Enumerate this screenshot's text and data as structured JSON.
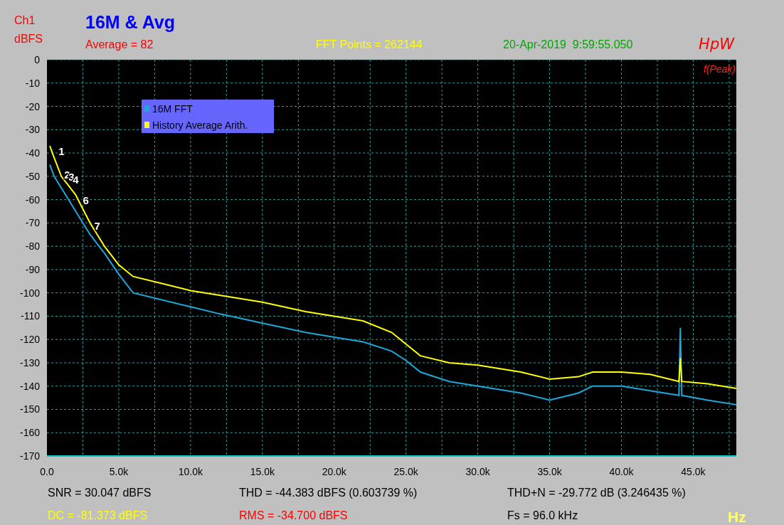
{
  "header": {
    "channel": "Ch1",
    "unit": "dBFS",
    "title": "16M & Avg",
    "average": "Average = 82",
    "fft_points": "FFT Points = 262144",
    "timestamp": "20-Apr-2019  9:59:55.050",
    "logo": "HpW"
  },
  "plot": {
    "corner_label": "f(Peak)",
    "chart_data": {
      "type": "line",
      "xlim": [
        0,
        48000
      ],
      "ylim": [
        -170,
        0
      ],
      "x": [
        200,
        500,
        1000,
        1500,
        2000,
        2500,
        3000,
        3500,
        4000,
        5000,
        6000,
        8000,
        10000,
        12000,
        15000,
        18000,
        20000,
        22000,
        24000,
        25000,
        26000,
        28000,
        30000,
        33000,
        35000,
        37000,
        38000,
        40000,
        42000,
        44000,
        44100,
        44200,
        46000,
        48000
      ],
      "series": [
        {
          "name": "16M FFT",
          "color": "#1ca8d8",
          "values": [
            -45,
            -50,
            -55,
            -60,
            -65,
            -70,
            -75,
            -79,
            -83,
            -92,
            -100,
            -103,
            -106,
            -109,
            -113,
            -117,
            -119,
            -121,
            -125,
            -129,
            -134,
            -138,
            -140,
            -143,
            -146,
            -143,
            -140,
            -140,
            -142,
            -144,
            -115,
            -144,
            -146,
            -148
          ]
        },
        {
          "name": "History Average Arith.",
          "color": "#ffff00",
          "values": [
            -37,
            -42,
            -50,
            -54,
            -58,
            -64,
            -70,
            -75,
            -80,
            -88,
            -93,
            -96,
            -99,
            -101,
            -104,
            -108,
            -110,
            -112,
            -117,
            -122,
            -127,
            -130,
            -131,
            -134,
            -137,
            -136,
            -134,
            -134,
            -135,
            -138,
            -128,
            -138,
            -139,
            -141
          ]
        }
      ],
      "xticks": [
        {
          "value": 0,
          "label": "0.0"
        },
        {
          "value": 5000,
          "label": "5.0k"
        },
        {
          "value": 10000,
          "label": "10.0k"
        },
        {
          "value": 15000,
          "label": "15.0k"
        },
        {
          "value": 20000,
          "label": "20.0k"
        },
        {
          "value": 25000,
          "label": "25.0k"
        },
        {
          "value": 30000,
          "label": "30.0k"
        },
        {
          "value": 35000,
          "label": "35.0k"
        },
        {
          "value": 40000,
          "label": "40.0k"
        },
        {
          "value": 45000,
          "label": "45.0k"
        }
      ],
      "yticks": [
        0,
        -10,
        -20,
        -30,
        -40,
        -50,
        -60,
        -70,
        -80,
        -90,
        -100,
        -110,
        -120,
        -130,
        -140,
        -150,
        -160,
        -170
      ],
      "grid": true,
      "legend": "upper left"
    },
    "peak_markers": [
      "1",
      "2",
      "3",
      "4",
      "6",
      "7"
    ]
  },
  "stats": [
    {
      "text": "SNR = 30.047 dBFS",
      "color": "#000000"
    },
    {
      "text": "THD = -44.383 dBFS (0.603739 %)",
      "color": "#000000"
    },
    {
      "text": "THD+N = -29.772 dB (3.246435 %)",
      "color": "#000000"
    },
    {
      "text": "DC = -81.373 dBFS",
      "color": "#ffff00"
    },
    {
      "text": "RMS = -34.700 dBFS",
      "color": "#ff0000"
    },
    {
      "text": "Fs = 96.0 kHz",
      "color": "#000000"
    }
  ],
  "x_unit": "Hz"
}
